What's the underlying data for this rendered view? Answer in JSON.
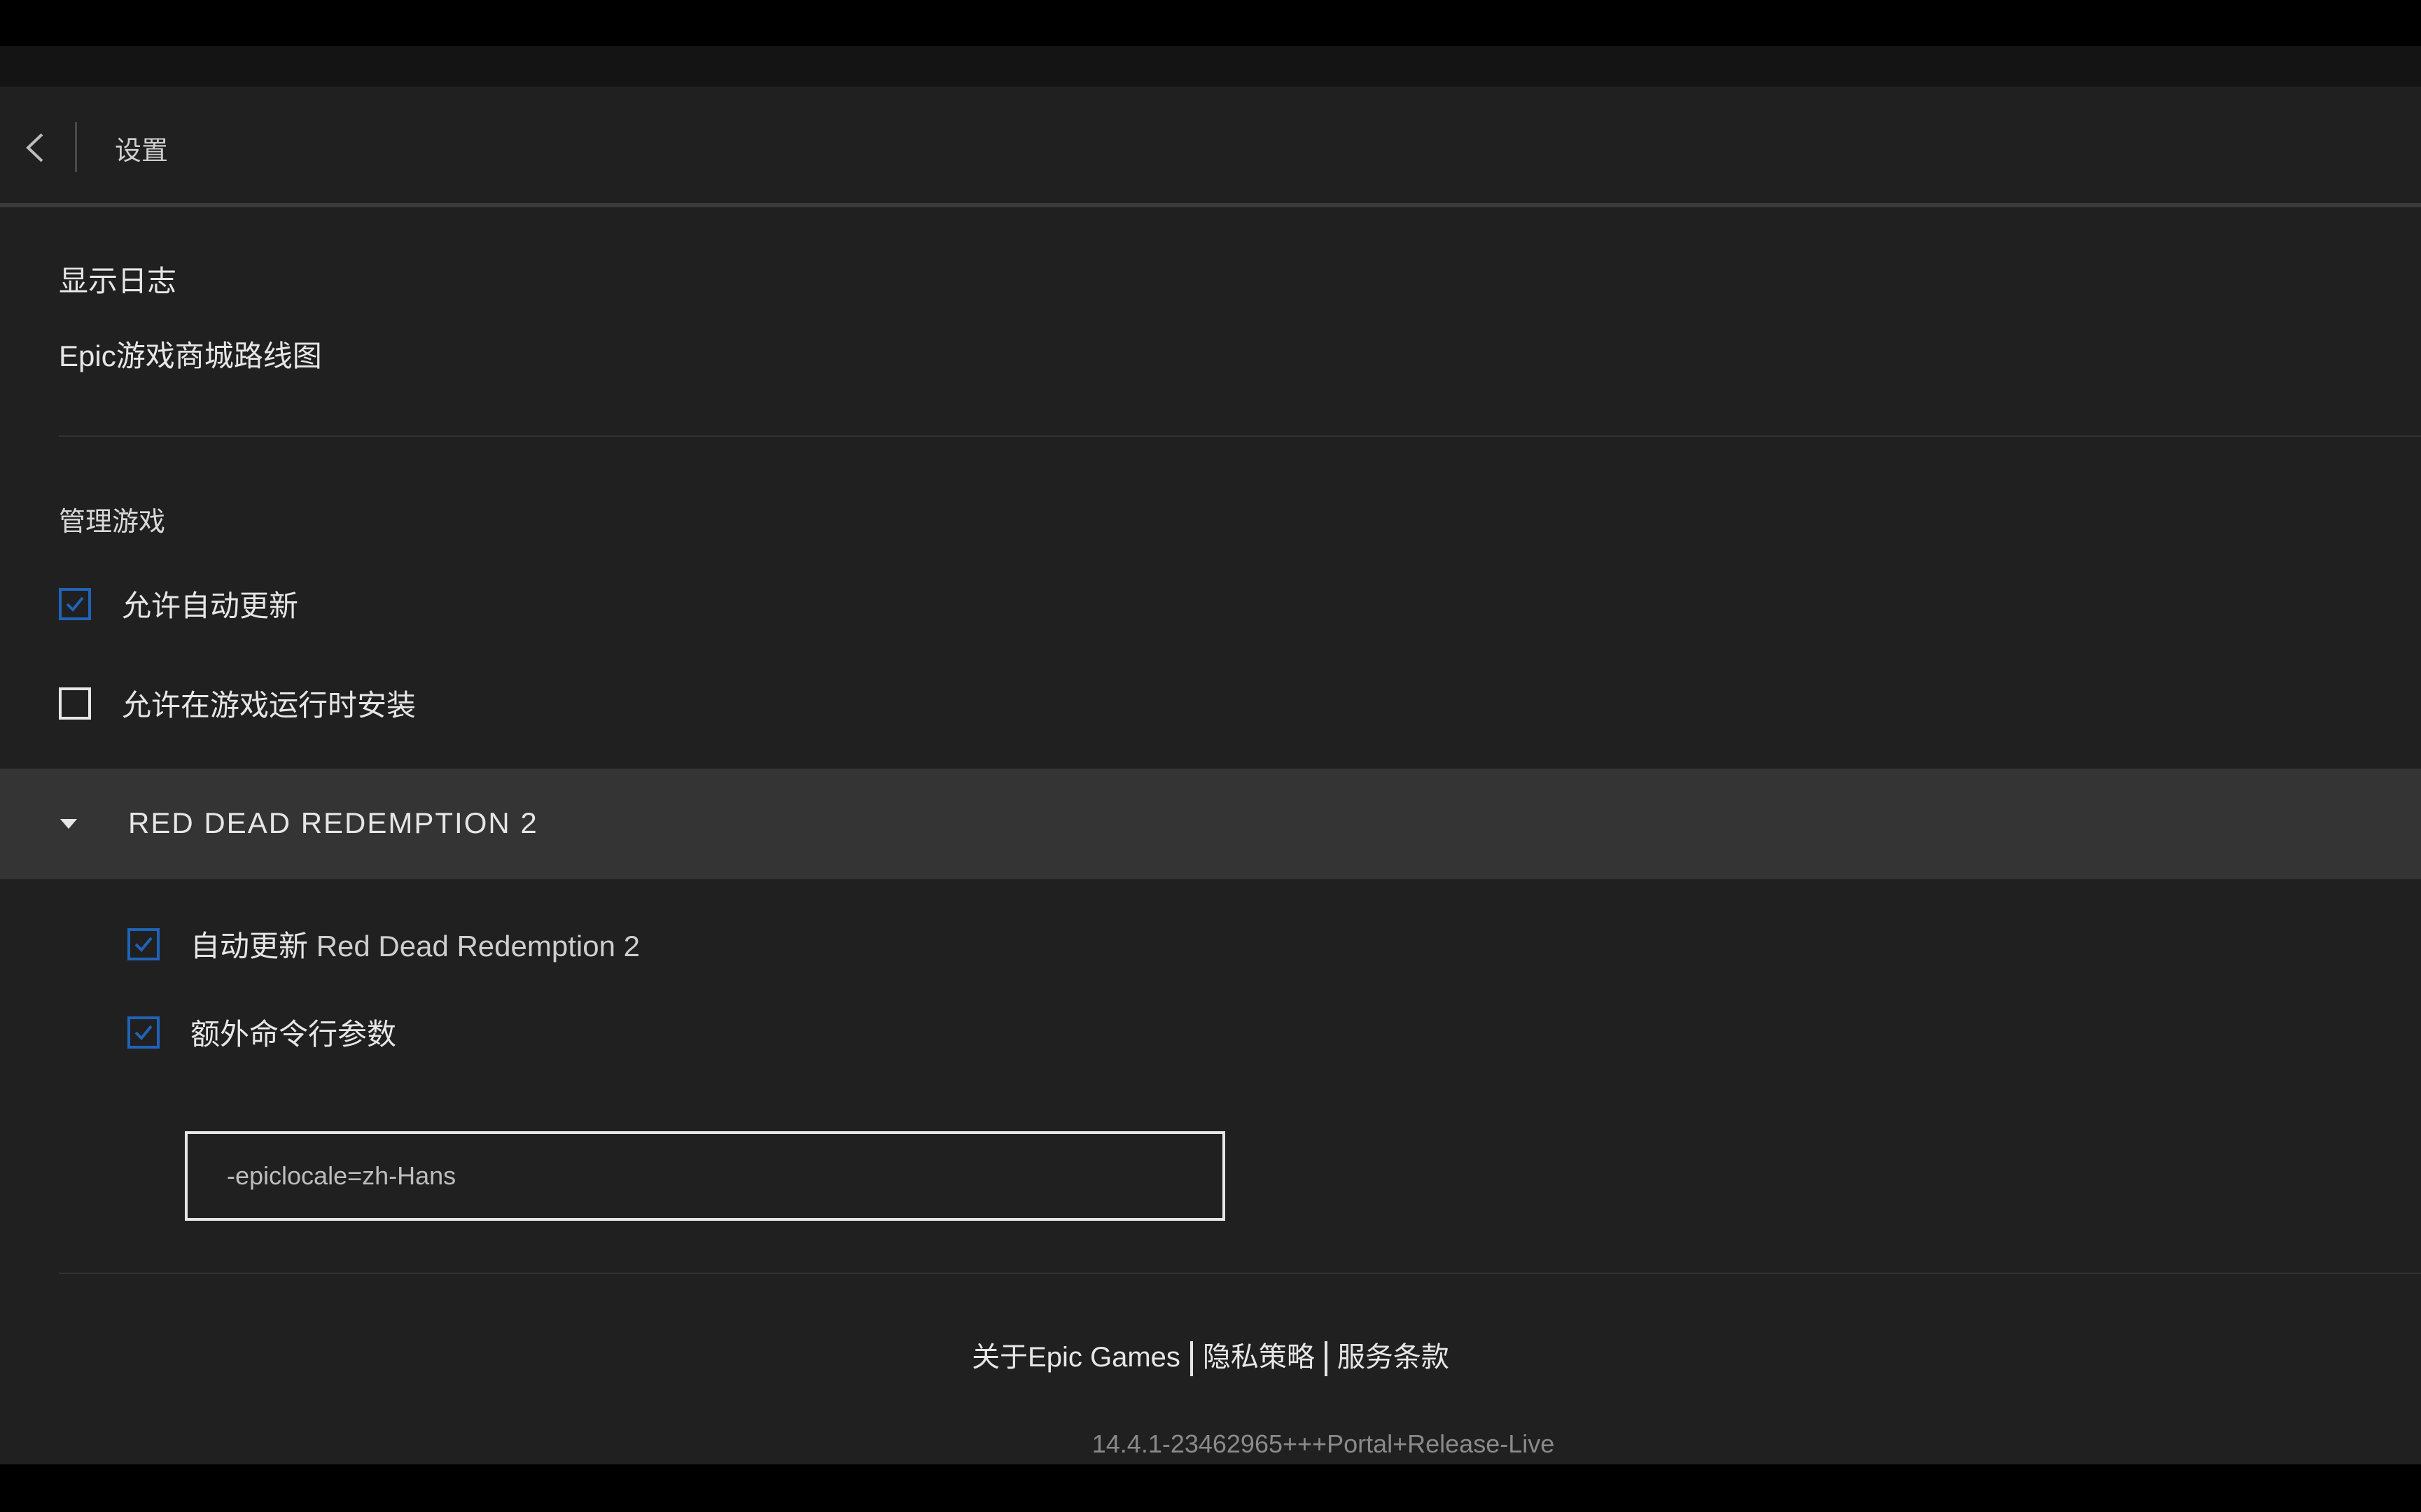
{
  "header": {
    "title": "设置"
  },
  "links": {
    "show_logs": "显示日志",
    "roadmap": "Epic游戏商城路线图"
  },
  "manage_games": {
    "section_title": "管理游戏",
    "allow_auto_update": {
      "label": "允许自动更新",
      "checked": true
    },
    "allow_install_while_running": {
      "label": "允许在游戏运行时安装",
      "checked": false
    }
  },
  "game": {
    "title": "RED DEAD REDEMPTION 2",
    "auto_update": {
      "label_prefix": "自动更新",
      "label_game": "Red Dead Redemption 2",
      "checked": true
    },
    "extra_args": {
      "label": "额外命令行参数",
      "checked": true,
      "value": "-epiclocale=zh-Hans"
    }
  },
  "footer": {
    "about": "关于Epic Games",
    "privacy": "隐私策略",
    "terms": "服务条款",
    "version": "14.4.1-23462965+++Portal+Release-Live"
  },
  "colors": {
    "accent": "#2063b9",
    "background": "#202020",
    "expanded_row": "#343434"
  }
}
